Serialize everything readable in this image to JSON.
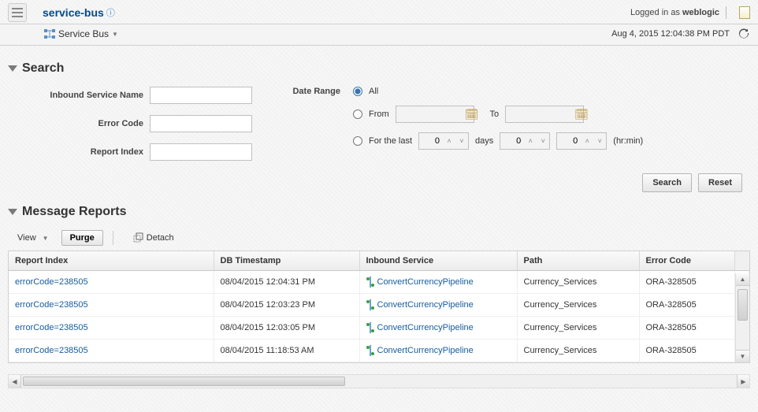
{
  "header": {
    "title": "service-bus",
    "logged_in_prefix": "Logged in as",
    "logged_in_user": "weblogic"
  },
  "subheader": {
    "breadcrumb": "Service Bus",
    "timestamp": "Aug 4, 2015 12:04:38 PM PDT"
  },
  "search": {
    "section_title": "Search",
    "labels": {
      "inbound_service_name": "Inbound Service Name",
      "error_code": "Error Code",
      "report_index": "Report Index",
      "date_range": "Date Range",
      "all": "All",
      "from": "From",
      "to": "To",
      "for_the_last": "For the last",
      "days": "days",
      "hrmin": "(hr:min)"
    },
    "values": {
      "inbound_service_name": "",
      "error_code": "",
      "report_index": "",
      "days": "0",
      "hr": "0",
      "min": "0",
      "from_date": "",
      "to_date": ""
    },
    "buttons": {
      "search": "Search",
      "reset": "Reset"
    }
  },
  "reports": {
    "section_title": "Message Reports",
    "toolbar": {
      "view": "View",
      "purge": "Purge",
      "detach": "Detach"
    },
    "columns": {
      "report_index": "Report Index",
      "db_timestamp": "DB Timestamp",
      "inbound_service": "Inbound Service",
      "path": "Path",
      "error_code": "Error Code"
    },
    "rows": [
      {
        "report_index": "errorCode=238505",
        "db_timestamp": "08/04/2015 12:04:31 PM",
        "inbound_service": "ConvertCurrencyPipeline",
        "path": "Currency_Services",
        "error_code": "ORA-328505"
      },
      {
        "report_index": "errorCode=238505",
        "db_timestamp": "08/04/2015 12:03:23 PM",
        "inbound_service": "ConvertCurrencyPipeline",
        "path": "Currency_Services",
        "error_code": "ORA-328505"
      },
      {
        "report_index": "errorCode=238505",
        "db_timestamp": "08/04/2015 12:03:05 PM",
        "inbound_service": "ConvertCurrencyPipeline",
        "path": "Currency_Services",
        "error_code": "ORA-328505"
      },
      {
        "report_index": "errorCode=238505",
        "db_timestamp": "08/04/2015 11:18:53 AM",
        "inbound_service": "ConvertCurrencyPipeline",
        "path": "Currency_Services",
        "error_code": "ORA-328505"
      }
    ]
  }
}
